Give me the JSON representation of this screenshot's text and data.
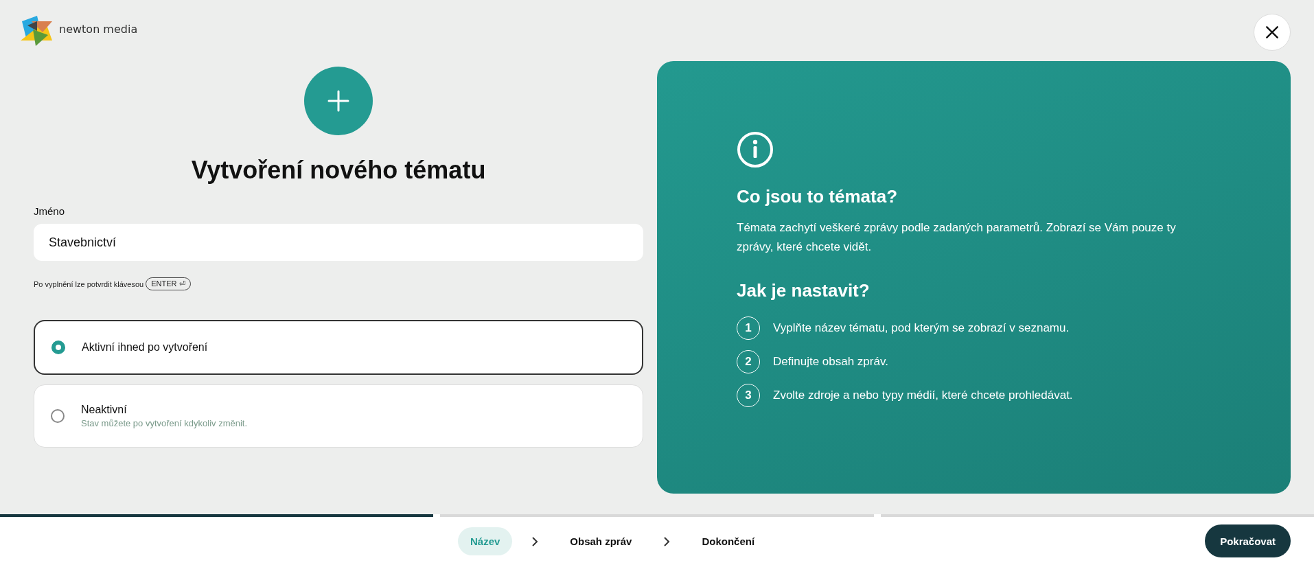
{
  "logo": {
    "text": "newton media"
  },
  "form": {
    "title": "Vytvoření nového tématu",
    "name_label": "Jméno",
    "name_value": "Stavebnictví",
    "hint": "Po vyplnění lze potvrdit klávesou",
    "hint_key": "ENTER",
    "hint_key_symbol": "⏎",
    "options": [
      {
        "label": "Aktivní ihned po vytvoření",
        "selected": true
      },
      {
        "label": "Neaktivní",
        "note": "Stav můžete po vytvoření kdykoliv změnit.",
        "selected": false
      }
    ]
  },
  "info": {
    "heading1": "Co jsou to témata?",
    "text": "Témata zachytí veškeré zprávy podle zadaných parametrů. Zobrazí se Vám pouze ty zprávy, které chcete vidět.",
    "heading2": "Jak je nastavit?",
    "steps": [
      {
        "number": "1",
        "text": "Vyplňte název tématu, pod kterým se zobrazí v seznamu."
      },
      {
        "number": "2",
        "text": "Definujte obsah zpráv."
      },
      {
        "number": "3",
        "text": "Zvolte zdroje a nebo typy médií, které chcete prohledávat."
      }
    ]
  },
  "progress": [
    {
      "level": 1
    },
    {
      "level": 0
    },
    {
      "level": 0
    }
  ],
  "wizard_steps": [
    {
      "label": "Název",
      "selected": true
    },
    {
      "label": "Obsah zpráv",
      "selected": false
    },
    {
      "label": "Dokončení",
      "selected": false
    }
  ],
  "continue_button": "Pokračovat"
}
